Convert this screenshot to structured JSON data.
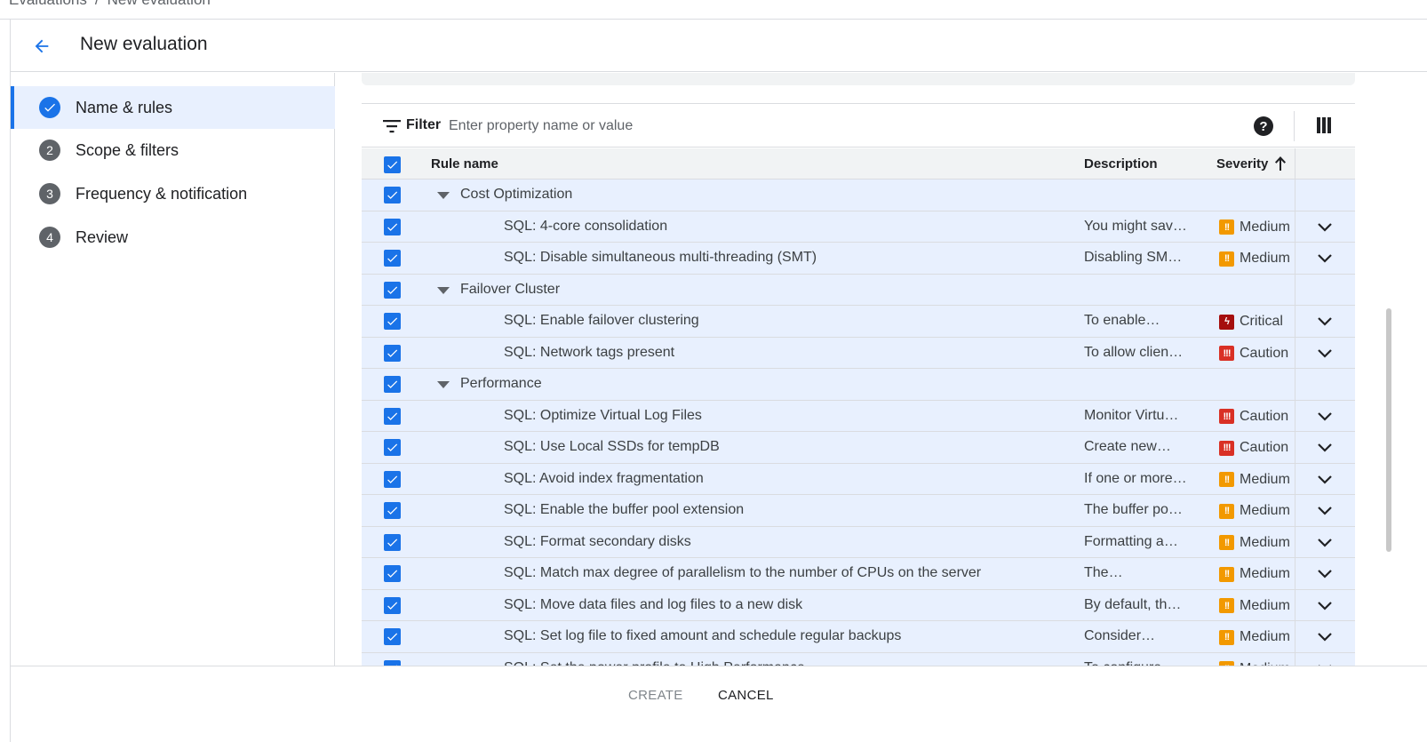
{
  "breadcrumb": {
    "root": "Evaluations",
    "separator": "/",
    "current": "New evaluation"
  },
  "header": {
    "title": "New evaluation"
  },
  "steps": [
    {
      "number": "1",
      "label": "Name & rules",
      "state": "complete"
    },
    {
      "number": "2",
      "label": "Scope & filters",
      "state": "pending"
    },
    {
      "number": "3",
      "label": "Frequency & notification",
      "state": "pending"
    },
    {
      "number": "4",
      "label": "Review",
      "state": "pending"
    }
  ],
  "filter": {
    "label": "Filter",
    "placeholder": "Enter property name or value",
    "help_icon": "?"
  },
  "table": {
    "columns": {
      "rule_name": "Rule name",
      "description": "Description",
      "severity": "Severity",
      "sort": "ascending"
    },
    "severity_colors": {
      "Medium": "#f29900",
      "Critical": "#a50e0e",
      "Caution": "#d93025"
    },
    "severity_glyphs": {
      "Medium": "!!",
      "Critical": "ϟ",
      "Caution": "!!!"
    },
    "rows": [
      {
        "type": "group",
        "name": "Cost Optimization"
      },
      {
        "type": "rule",
        "name": "SQL: 4-core consolidation",
        "description": "You might sav…",
        "severity": "Medium"
      },
      {
        "type": "rule",
        "name": "SQL: Disable simultaneous multi-threading (SMT)",
        "description": "Disabling SM…",
        "severity": "Medium"
      },
      {
        "type": "group",
        "name": "Failover Cluster"
      },
      {
        "type": "rule",
        "name": "SQL: Enable failover clustering",
        "description": "To enable…",
        "severity": "Critical"
      },
      {
        "type": "rule",
        "name": "SQL: Network tags present",
        "description": "To allow clien…",
        "severity": "Caution"
      },
      {
        "type": "group",
        "name": "Performance"
      },
      {
        "type": "rule",
        "name": "SQL: Optimize Virtual Log Files",
        "description": "Monitor Virtu…",
        "severity": "Caution"
      },
      {
        "type": "rule",
        "name": "SQL: Use Local SSDs for tempDB",
        "description": "Create new…",
        "severity": "Caution"
      },
      {
        "type": "rule",
        "name": "SQL: Avoid index fragmentation",
        "description": "If one or more…",
        "severity": "Medium"
      },
      {
        "type": "rule",
        "name": "SQL: Enable the buffer pool extension",
        "description": "The buffer po…",
        "severity": "Medium"
      },
      {
        "type": "rule",
        "name": "SQL: Format secondary disks",
        "description": "Formatting a…",
        "severity": "Medium"
      },
      {
        "type": "rule",
        "name": "SQL: Match max degree of parallelism to the number of CPUs on the server",
        "description": "The…",
        "severity": "Medium"
      },
      {
        "type": "rule",
        "name": "SQL: Move data files and log files to a new disk",
        "description": "By default, th…",
        "severity": "Medium"
      },
      {
        "type": "rule",
        "name": "SQL: Set log file to fixed amount and schedule regular backups",
        "description": "Consider…",
        "severity": "Medium"
      },
      {
        "type": "rule",
        "name": "SQL: Set the power profile to High Performance",
        "description": "To configure…",
        "severity": "Medium"
      }
    ]
  },
  "footer": {
    "create_label": "CREATE",
    "cancel_label": "CANCEL"
  },
  "colors": {
    "accent": "#1a73e8",
    "selected_row": "#e8f0fe",
    "header_bg": "#f1f3f4",
    "divider": "#dadce0"
  }
}
